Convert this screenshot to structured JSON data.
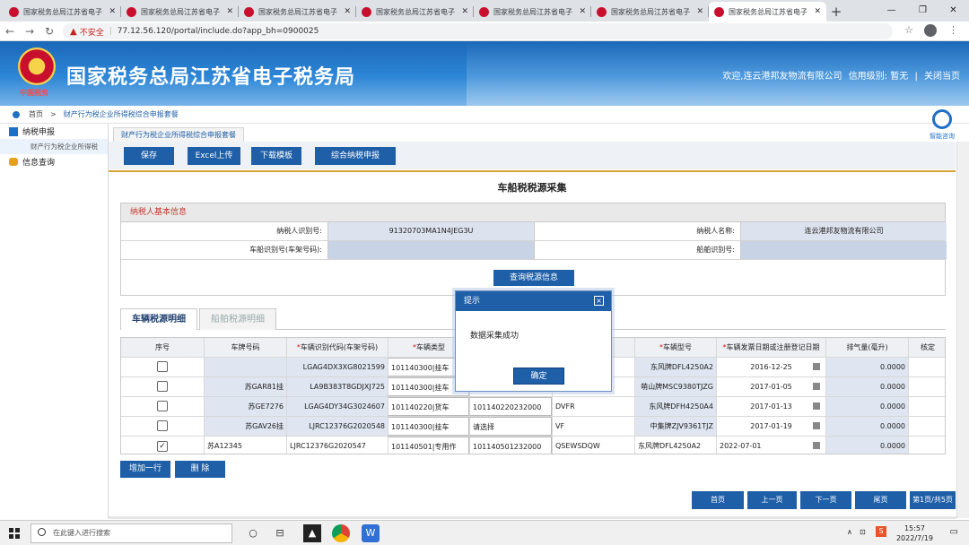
{
  "browser": {
    "tabs": [
      {
        "title": "国家税务总局江苏省电子",
        "active": false
      },
      {
        "title": "国家税务总局江苏省电子",
        "active": false
      },
      {
        "title": "国家税务总局江苏省电子",
        "active": false
      },
      {
        "title": "国家税务总局江苏省电子",
        "active": false
      },
      {
        "title": "国家税务总局江苏省电子",
        "active": false
      },
      {
        "title": "国家税务总局江苏省电子",
        "active": false
      },
      {
        "title": "国家税务总局江苏省电子",
        "active": true
      }
    ],
    "security_label": "不安全",
    "url": "77.12.56.120/portal/include.do?app_bh=0900025"
  },
  "banner": {
    "emblem_text": "中国税务",
    "site_title": "国家税务总局江苏省电子税务局",
    "welcome": "欢迎,连云港邦友物流有限公司",
    "credit_label": "信用级别: 暂无",
    "divider": "|",
    "logout": "关闭当页"
  },
  "breadcrumb": {
    "home": "首页",
    "sep": ">",
    "current": "财产行为税企业所得税综合申报套餐"
  },
  "sidebar": {
    "items": [
      {
        "label": "纳税申报"
      },
      {
        "label": "财产行为税企业所得税"
      },
      {
        "label": "信息查询"
      }
    ]
  },
  "assistant_label": "智能咨询",
  "main_tab": "财产行为税企业所得税综合申报套餐",
  "toolbar": {
    "save": "保存",
    "excel": "Excel上传",
    "download": "下载模板",
    "declare": "综合纳税申报"
  },
  "form": {
    "title": "车船税税源采集",
    "section_title": "纳税人基本信息",
    "taxpayer_id_label": "纳税人识别号:",
    "taxpayer_id": "91320703MA1N4JEG3U",
    "taxpayer_name_label": "纳税人名称:",
    "taxpayer_name": "连云港邦友物流有限公司",
    "vin_label": "车船识别号(车架号码):",
    "ship_id_label": "船舶识别号:",
    "query_button": "查询税源信息"
  },
  "subtabs": {
    "vehicle": "车辆税源明细",
    "ship": "船舶税源明细"
  },
  "table": {
    "columns": [
      "序号",
      "车牌号码",
      "车辆识别代码(车架号码)",
      "车辆类型",
      "",
      "",
      "车辆型号",
      "车辆发票日期或注册登记日期",
      "排气量(毫升)",
      "核定"
    ],
    "required": [
      false,
      false,
      true,
      true,
      false,
      false,
      true,
      true,
      false,
      false
    ],
    "rows": [
      {
        "checked": false,
        "plate": "",
        "vin": "LGAG4DX3XG8021599",
        "type": "101140300|挂车",
        "code": "",
        "engine": "",
        "model": "东风牌DFL4250A2",
        "date": "2016-12-25",
        "disp": "0.0000"
      },
      {
        "checked": false,
        "plate": "苏GAR81挂",
        "vin": "LA9B383T8GDJXJ725",
        "type": "101140300|挂车",
        "code": "",
        "engine": "",
        "model": "萌山牌MSC9380TJZG",
        "date": "2017-01-05",
        "disp": "0.0000"
      },
      {
        "checked": false,
        "plate": "苏GE7276",
        "vin": "LGAG4DY34G3024607",
        "type": "101140220|货车",
        "code": "101140220232000",
        "engine": "DVFR",
        "model": "东风牌DFH4250A4",
        "date": "2017-01-13",
        "disp": "0.0000"
      },
      {
        "checked": false,
        "plate": "苏GAV26挂",
        "vin": "LJRC12376G2020548",
        "type": "101140300|挂车",
        "code": "请选择",
        "engine": "VF",
        "model": "中集牌ZJV9361TJZ",
        "date": "2017-01-19",
        "disp": "0.0000"
      },
      {
        "checked": true,
        "plate": "苏A12345",
        "vin": "LJRC12376G2020547",
        "type": "101140501|专用作",
        "code": "101140501232000",
        "engine": "QSEWSDQW",
        "model": "东风牌DFL4250A2",
        "date": "2022-07-01",
        "disp": "0.0000"
      }
    ],
    "add_row": "增加一行",
    "delete": "删 除"
  },
  "pager": {
    "first": "首页",
    "prev": "上一页",
    "next": "下一页",
    "last": "尾页",
    "info": "第1页/共5页"
  },
  "dialog": {
    "title": "提示",
    "close": "×",
    "message": "数据采集成功",
    "ok": "确定"
  },
  "taskbar": {
    "search_placeholder": "在此键入进行搜索",
    "time": "15:57",
    "date": "2022/7/19",
    "ime": "S"
  }
}
